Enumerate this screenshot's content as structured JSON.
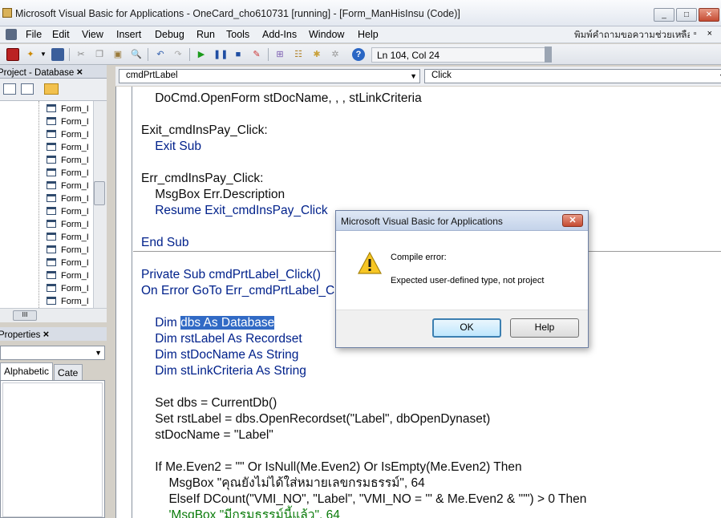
{
  "window": {
    "title": "Microsoft Visual Basic for Applications - OneCard_cho610731 [running] - [Form_ManHisInsu (Code)]",
    "buttons": [
      "_",
      "□",
      "✕"
    ]
  },
  "menu": {
    "items": [
      "File",
      "Edit",
      "View",
      "Insert",
      "Debug",
      "Run",
      "Tools",
      "Add-Ins",
      "Window",
      "Help"
    ],
    "help_box": "พิมพ์คำถามขอความช่วยเหลือ",
    "right_buttons": "- ▫ ×"
  },
  "toolbar": {
    "position": "Ln 104, Col 24"
  },
  "project_panel": {
    "title": "Project - Database",
    "close": "×",
    "items": [
      "Form_I",
      "Form_I",
      "Form_I",
      "Form_I",
      "Form_I",
      "Form_I",
      "Form_I",
      "Form_I",
      "Form_I",
      "Form_I",
      "Form_I",
      "Form_I",
      "Form_I",
      "Form_I",
      "Form_I",
      "Form_I"
    ],
    "hscroll_thumb": "III"
  },
  "properties_panel": {
    "title": "Properties",
    "close": "×",
    "tabs": [
      "Alphabetic",
      "Cate"
    ]
  },
  "code": {
    "object_combo": "cmdPrtLabel",
    "proc_combo": "Click",
    "lines": [
      "    DoCmd.OpenForm stDocName, , , stLinkCriteria",
      "",
      "Exit_cmdInsPay_Click:",
      "    Exit Sub",
      "",
      "Err_cmdInsPay_Click:",
      "    MsgBox Err.Description",
      "    Resume Exit_cmdInsPay_Click",
      "",
      "End Sub",
      "",
      "Private Sub cmdPrtLabel_Click()",
      "On Error GoTo Err_cmdPrtLabel_C",
      "",
      "    Dim ",
      "    Dim rstLabel As Recordset",
      "    Dim stDocName As String",
      "    Dim stLinkCriteria As String",
      "",
      "    Set dbs = CurrentDb()",
      "    Set rstLabel = dbs.OpenRecordset(\"Label\", dbOpenDynaset)",
      "    stDocName = \"Label\"",
      "",
      "    If Me.Even2 = \"\" Or IsNull(Me.Even2) Or IsEmpty(Me.Even2) Then",
      "        MsgBox \"คุณยังไม่ได้ใส่หมายเลขกรมธรรม์\", 64",
      "        ElseIf DCount(\"VMI_NO\", \"Label\", \"VMI_NO = '\" & Me.Even2 & \"'\") > 0 Then",
      "        'MsgBox \"มีกรมธรรม์นี้แล้ว\", 64"
    ],
    "selected_text": "dbs As Database"
  },
  "dialog": {
    "title": "Microsoft Visual Basic for Applications",
    "close": "✕",
    "message_title": "Compile error:",
    "message": "Expected user-defined type, not project",
    "ok_label": "OK",
    "help_label": "Help"
  }
}
